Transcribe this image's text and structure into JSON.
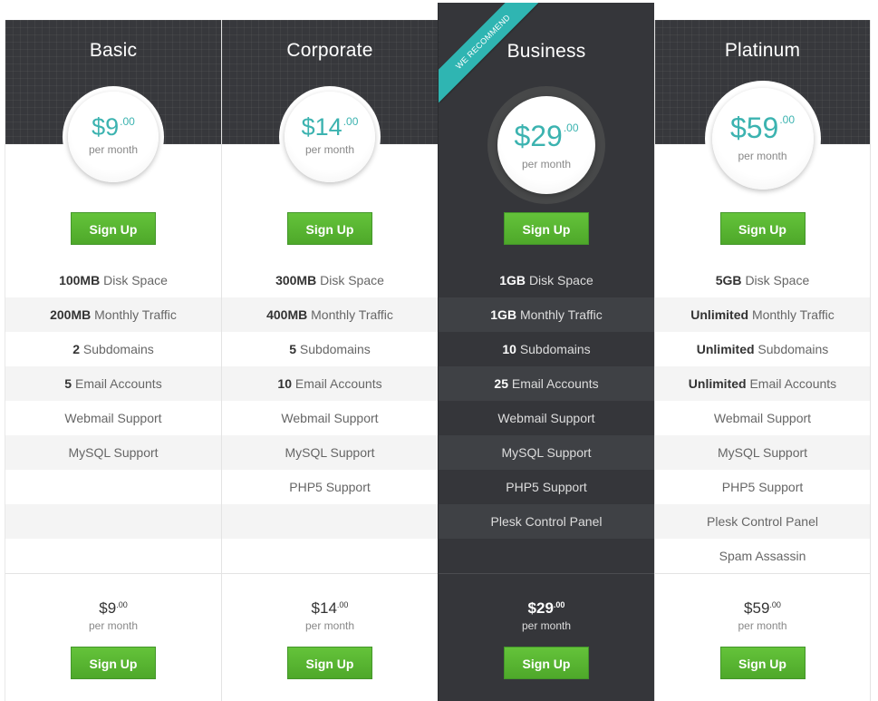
{
  "plans": [
    {
      "name": "Basic",
      "price": "$9",
      "cents": ".00",
      "period": "per month",
      "cta": "Sign Up",
      "features": [
        {
          "bold": "100MB",
          "text": "Disk Space"
        },
        {
          "bold": "200MB",
          "text": "Monthly Traffic"
        },
        {
          "bold": "2",
          "text": "Subdomains"
        },
        {
          "bold": "5",
          "text": "Email Accounts"
        },
        {
          "bold": "",
          "text": "Webmail Support"
        },
        {
          "bold": "",
          "text": "MySQL Support"
        },
        {
          "bold": "",
          "text": ""
        },
        {
          "bold": "",
          "text": ""
        },
        {
          "bold": "",
          "text": ""
        }
      ]
    },
    {
      "name": "Corporate",
      "price": "$14",
      "cents": ".00",
      "period": "per month",
      "cta": "Sign Up",
      "features": [
        {
          "bold": "300MB",
          "text": "Disk Space"
        },
        {
          "bold": "400MB",
          "text": "Monthly Traffic"
        },
        {
          "bold": "5",
          "text": "Subdomains"
        },
        {
          "bold": "10",
          "text": "Email Accounts"
        },
        {
          "bold": "",
          "text": "Webmail Support"
        },
        {
          "bold": "",
          "text": "MySQL Support"
        },
        {
          "bold": "",
          "text": "PHP5 Support"
        },
        {
          "bold": "",
          "text": ""
        },
        {
          "bold": "",
          "text": ""
        }
      ]
    },
    {
      "name": "Business",
      "ribbon": "WE RECOMMEND",
      "price": "$29",
      "cents": ".00",
      "period": "per month",
      "cta": "Sign Up",
      "features": [
        {
          "bold": "1GB",
          "text": "Disk Space"
        },
        {
          "bold": "1GB",
          "text": "Monthly Traffic"
        },
        {
          "bold": "10",
          "text": "Subdomains"
        },
        {
          "bold": "25",
          "text": "Email Accounts"
        },
        {
          "bold": "",
          "text": "Webmail Support"
        },
        {
          "bold": "",
          "text": "MySQL Support"
        },
        {
          "bold": "",
          "text": "PHP5 Support"
        },
        {
          "bold": "",
          "text": "Plesk Control Panel"
        },
        {
          "bold": "",
          "text": ""
        }
      ]
    },
    {
      "name": "Platinum",
      "price": "$59",
      "cents": ".00",
      "period": "per month",
      "cta": "Sign Up",
      "features": [
        {
          "bold": "5GB",
          "text": "Disk Space"
        },
        {
          "bold": "Unlimited",
          "text": "Monthly Traffic"
        },
        {
          "bold": "Unlimited",
          "text": "Subdomains"
        },
        {
          "bold": "Unlimited",
          "text": "Email Accounts"
        },
        {
          "bold": "",
          "text": "Webmail Support"
        },
        {
          "bold": "",
          "text": "MySQL Support"
        },
        {
          "bold": "",
          "text": "PHP5 Support"
        },
        {
          "bold": "",
          "text": "Plesk Control Panel"
        },
        {
          "bold": "",
          "text": "Spam Assassin"
        }
      ]
    }
  ],
  "colors": {
    "accent": "#3cb3b0",
    "button_green": "#5ab832",
    "featured_bg": "#35363a",
    "ribbon": "#2fb5b2"
  }
}
